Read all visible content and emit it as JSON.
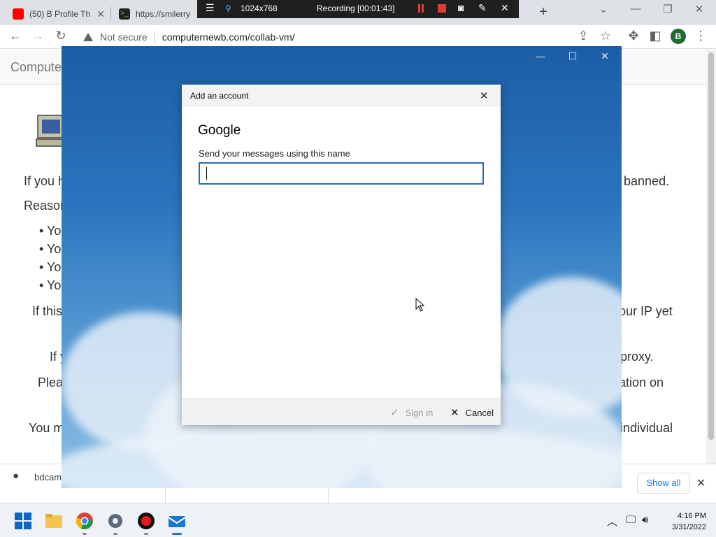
{
  "browser": {
    "tabs": [
      {
        "label": "(50) B Profile Th",
        "favicon_color": "#ff0000"
      },
      {
        "label": "https://smilerry",
        "favicon_color": "#222222"
      }
    ],
    "new_tab_glyph": "+",
    "address": {
      "security_label": "Not secure",
      "url": "computernewb.com/collab-vm/"
    },
    "profile_initial": "B"
  },
  "recorder": {
    "resolution": "1024x768",
    "status": "Recording [00:01:43]"
  },
  "webpage": {
    "site_title": "Compute",
    "fragments": {
      "p1_left": "If you h",
      "p1_right": "n banned.",
      "p2_left": "Reasor",
      "bullets": [
        "Yo",
        "Yo",
        "Yo",
        "Yo"
      ],
      "p3_left": "If this",
      "p3_right": "our IP yet",
      "p4_left": "If y",
      "p4_right": "proxy.",
      "p5_left": "Plea",
      "p5_right": "ation on",
      "p6_left": "You m",
      "p6_right": "individual"
    }
  },
  "downloads": {
    "item1": "bdcam",
    "show_all": "Show all"
  },
  "mail_app": {
    "dialog": {
      "title": "Add an account",
      "provider": "Google",
      "label": "Send your messages using this name",
      "name_value": "",
      "signin_label": "Sign in",
      "cancel_label": "Cancel"
    }
  },
  "taskbar": {
    "time": "4:16 PM",
    "date": "3/31/2022"
  },
  "colors": {
    "accent_input_border": "#2b6cb0",
    "chrome_tabstrip": "#dee1e6",
    "recorder_bar": "#1f1f1f",
    "record_red": "#e53935"
  }
}
